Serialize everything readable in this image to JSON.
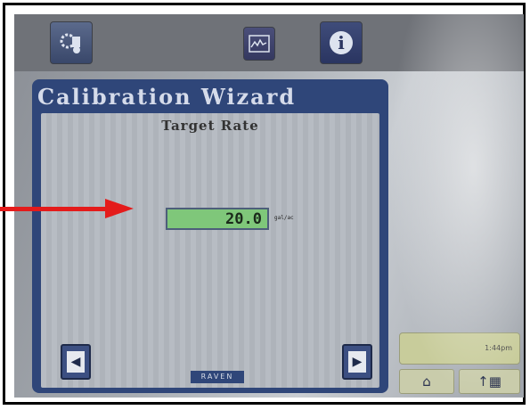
{
  "top_bar": {
    "settings_icon": "tractor-gear-icon",
    "graph_icon": "graph-icon",
    "info_icon": "info-icon",
    "info_glyph": "i"
  },
  "wizard": {
    "title": "Calibration Wizard",
    "subtitle": "Target Rate",
    "rate_value": "20.0",
    "rate_unit": "gal/ac",
    "back_icon": "back-arrow-icon",
    "next_icon": "next-arrow-icon",
    "brand": "RAVEN"
  },
  "status": {
    "time": "1:44pm"
  },
  "bottom_buttons": {
    "home_icon": "home-icon",
    "menu_icon": "menu-grid-icon"
  },
  "colors": {
    "wizard_frame": "#2f4679",
    "rate_field": "#7fc77a",
    "annotation_arrow": "#e41b1b"
  }
}
